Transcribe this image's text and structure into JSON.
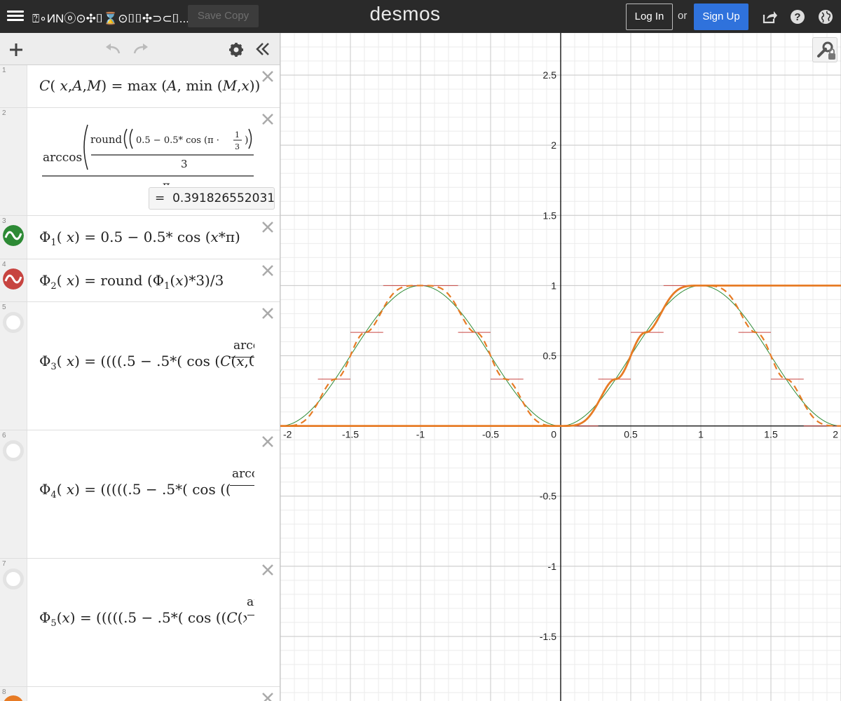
{
  "header": {
    "title": "⍰∘ИNⓞ⊙✣⌷⌛⊙⌷⌷✣⊃⊂⌷...",
    "save_copy": "Save Copy",
    "logo": "desmos",
    "login": "Log In",
    "or": "or",
    "signup": "Sign Up"
  },
  "expressions": [
    {
      "index": "1",
      "delete_icon": "close-icon"
    },
    {
      "index": "2",
      "result_eq": "=",
      "result": "0.391826552031",
      "delete_icon": "close-icon"
    },
    {
      "index": "3",
      "color": "#2d8a35",
      "icon": "sine-wave-icon",
      "delete_icon": "close-icon"
    },
    {
      "index": "4",
      "color": "#c74440",
      "icon": "sine-wave-icon",
      "delete_icon": "close-icon"
    },
    {
      "index": "5",
      "icon": "hidden-ring-icon",
      "delete_icon": "close-icon"
    },
    {
      "index": "6",
      "icon": "hidden-ring-icon",
      "delete_icon": "close-icon"
    },
    {
      "index": "7",
      "icon": "hidden-ring-icon",
      "delete_icon": "close-icon"
    },
    {
      "index": "8",
      "color": "#e77b25",
      "icon": "color-dot-icon",
      "delete_icon": "close-icon"
    }
  ],
  "graph": {
    "x_ticks": [
      "-2",
      "-1.5",
      "-1",
      "-0.5",
      "0",
      "0.5",
      "1",
      "1.5",
      "2"
    ],
    "y_ticks": [
      "2.5",
      "2",
      "1.5",
      "1",
      "0.5",
      "-0.5",
      "-1",
      "-1.5"
    ],
    "xlim": [
      -2,
      2
    ],
    "ylim": [
      -1.96,
      2.8
    ],
    "curve_colors": {
      "phi1": "#2d8a35",
      "phi2": "#c74440",
      "orange": "#e77b25"
    }
  }
}
